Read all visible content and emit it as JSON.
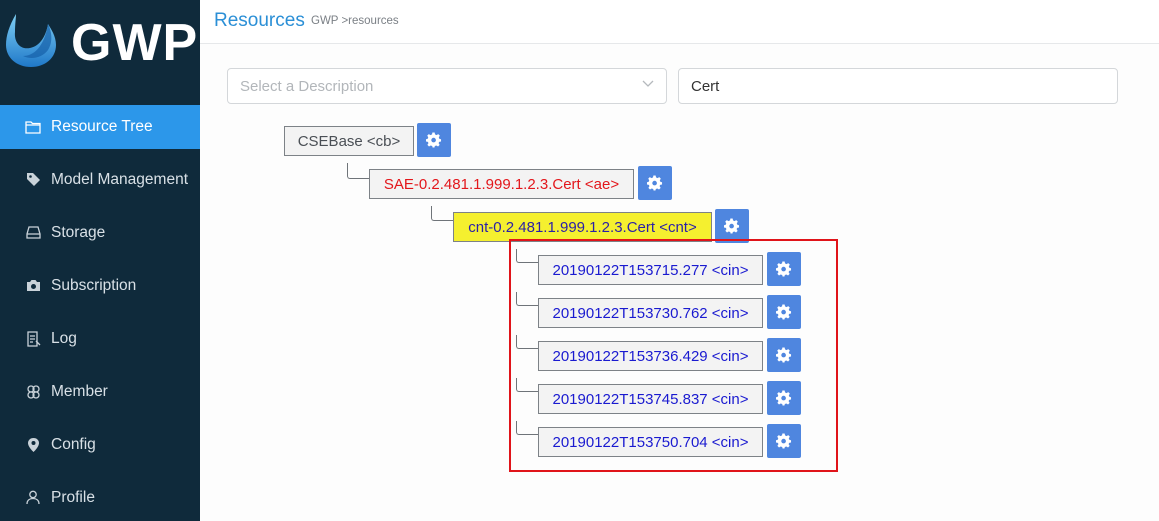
{
  "app": {
    "logo_text": "GWP"
  },
  "sidebar": {
    "items": [
      {
        "label": "Resource Tree",
        "icon": "folder-icon",
        "active": true
      },
      {
        "label": "Model Management",
        "icon": "tag-icon"
      },
      {
        "label": "Storage",
        "icon": "storage-icon"
      },
      {
        "label": "Subscription",
        "icon": "camera-icon"
      },
      {
        "label": "Log",
        "icon": "log-icon"
      },
      {
        "label": "Member",
        "icon": "member-icon"
      },
      {
        "label": "Config",
        "icon": "location-icon"
      },
      {
        "label": "Profile",
        "icon": "user-icon"
      }
    ]
  },
  "header": {
    "title": "Resources",
    "breadcrumb": "GWP >resources"
  },
  "filters": {
    "description_placeholder": "Select a Description",
    "search_value": "Cert"
  },
  "tree": {
    "cb": "CSEBase <cb>",
    "ae": "SAE-0.2.481.1.999.1.2.3.Cert <ae>",
    "cnt": "cnt-0.2.481.1.999.1.2.3.Cert <cnt>",
    "cins": [
      "20190122T153715.277 <cin>",
      "20190122T153730.762 <cin>",
      "20190122T153736.429 <cin>",
      "20190122T153745.837 <cin>",
      "20190122T153750.704 <cin>"
    ]
  },
  "colors": {
    "sidebar_bg": "#0f2a3b",
    "active_item": "#2c97ea",
    "accent": "#4f86df",
    "ae_text": "#e3161b",
    "cnt_bg": "#f5f02f",
    "cin_text": "#1a1ad0",
    "highlight": "#e0141a"
  }
}
